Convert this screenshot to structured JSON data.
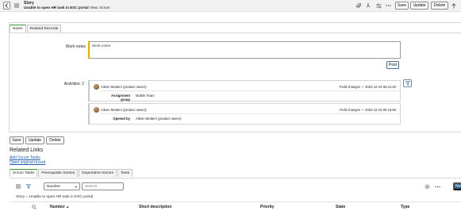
{
  "header": {
    "record_type": "Story",
    "record_title": "Unable to open HR task in ESC portal",
    "view_label": "View: Scrum",
    "buttons": {
      "save": "Save",
      "update": "Update",
      "delete": "Delete"
    }
  },
  "form_tabs": [
    "Notes",
    "Related Records"
  ],
  "notes": {
    "work_notes_label": "Work notes",
    "work_notes_placeholder": "Work notes",
    "post_label": "Post",
    "activities_label": "Activities: 2"
  },
  "activities": [
    {
      "author": "Aileen Mottern (product owner)",
      "change_type": "Field changes",
      "timestamp": "2022-12-23 05:21:20",
      "field": "Assignment group",
      "value": "Mobile Team"
    },
    {
      "author": "Aileen Mottern (product owner)",
      "change_type": "Field changes",
      "timestamp": "2022-12-23 05:16:56",
      "field": "Opened by",
      "value": "Aileen Mottern (product owner)"
    }
  ],
  "form_buttons": {
    "save": "Save",
    "update": "Update",
    "delete": "Delete"
  },
  "related_links": {
    "title": "Related Links",
    "add_scrum_tasks": "Add Scrum Tasks",
    "open_original_record": "Open original record"
  },
  "related_tabs": [
    "Scrum Tasks",
    "Prerequisite Stories",
    "Dependent Stories",
    "Tests"
  ],
  "list": {
    "field_select": "Number",
    "search_placeholder": "Search",
    "new_label": "New",
    "breadcrumb": "Story = Unable to open HR task in ESC portal",
    "columns": [
      "Number",
      "Short description",
      "Priority",
      "State",
      "Type"
    ],
    "sort_indicator": "▲"
  },
  "colors": {
    "accent_green": "#3d8f3d",
    "new_button": "#2e5b8c",
    "link": "#1f5fb0",
    "work_notes_bar": "#e0b000"
  }
}
